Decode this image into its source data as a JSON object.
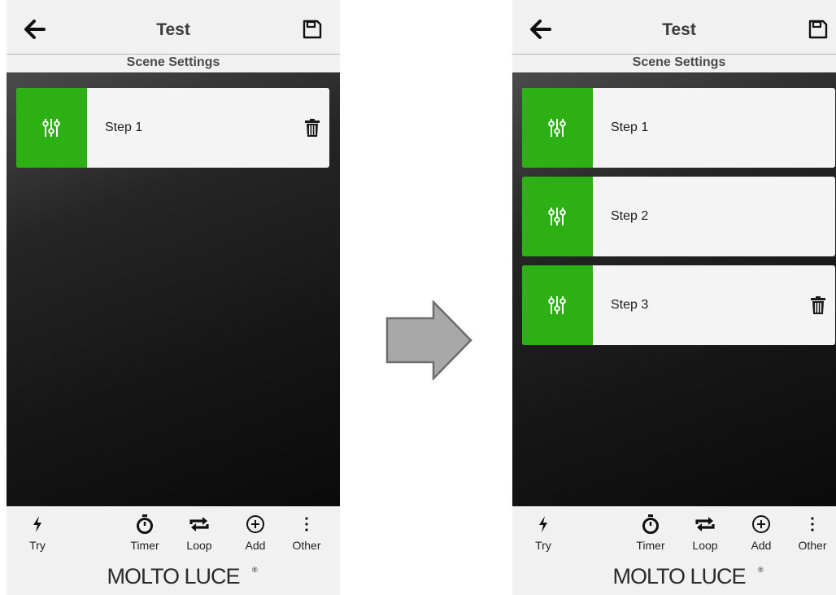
{
  "left_screen": {
    "header": {
      "title": "Test"
    },
    "subheader": "Scene Settings",
    "steps": [
      {
        "label": "Step 1"
      }
    ],
    "toolbar": {
      "try": "Try",
      "timer": "Timer",
      "loop": "Loop",
      "add": "Add",
      "other": "Other"
    },
    "brand": "MOLTO LUCE"
  },
  "right_screen": {
    "header": {
      "title": "Test"
    },
    "subheader": "Scene Settings",
    "steps": [
      {
        "label": "Step 1"
      },
      {
        "label": "Step 2"
      },
      {
        "label": "Step 3"
      }
    ],
    "toolbar": {
      "try": "Try",
      "timer": "Timer",
      "loop": "Loop",
      "add": "Add",
      "other": "Other"
    },
    "brand": "MOLTO LUCE"
  },
  "colors": {
    "accent_green": "#2db013",
    "content_dark": "#161616",
    "bar_bg": "#f1f1f1"
  },
  "icons": [
    "back-arrow-icon",
    "save-icon",
    "sliders-icon",
    "trash-icon",
    "bolt-icon",
    "stopwatch-icon",
    "repeat-icon",
    "plus-circle-icon",
    "more-vertical-icon",
    "right-arrow-icon"
  ]
}
